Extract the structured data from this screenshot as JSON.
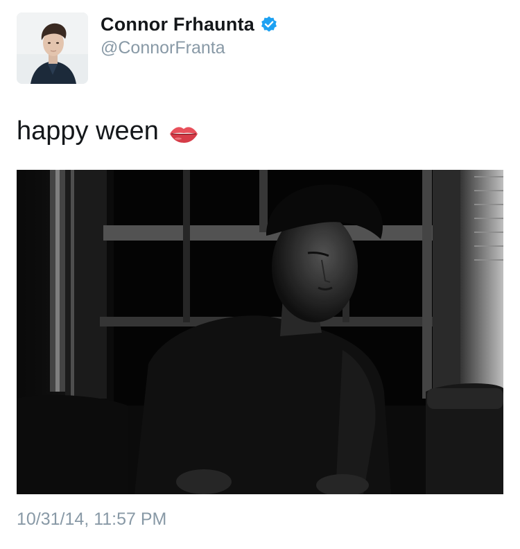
{
  "user": {
    "display_name": "Connor Frhaunta",
    "handle": "@ConnorFranta",
    "verified": true,
    "avatar_icon": "profile-photo",
    "verified_icon": "verified-badge-icon",
    "verified_color": "#1da1f2"
  },
  "tweet": {
    "text": "happy ween",
    "emoji_icon": "lips-emoji-icon",
    "media_description_icon": "tweet-photo",
    "timestamp": "10/31/14, 11:57 PM"
  },
  "colors": {
    "text": "#14171a",
    "secondary_text": "#8899a6",
    "background": "#ffffff"
  }
}
